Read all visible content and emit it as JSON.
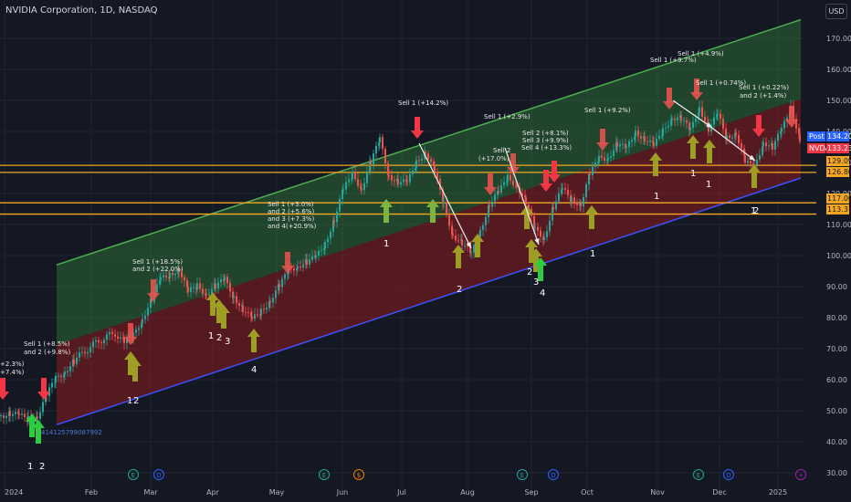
{
  "header": {
    "title": "NVIDIA Corporation, 1D, NASDAQ",
    "currency": "USD"
  },
  "chart_data": {
    "type": "candlestick",
    "title": "NVIDIA Corporation, 1D, NASDAQ",
    "ylim": [
      28,
      180
    ],
    "y_ticks": [
      30,
      40,
      50,
      60,
      70,
      80,
      90,
      100,
      110,
      120,
      130,
      140,
      150,
      160,
      170
    ],
    "x_tick_labels": [
      "2024",
      "Feb",
      "Mar",
      "Apr",
      "May",
      "Jun",
      "Jul",
      "Aug",
      "Sep",
      "Oct",
      "Nov",
      "Dec",
      "2025"
    ],
    "grid": true,
    "channel": {
      "upper_start": 97,
      "upper_end": 176,
      "lower_start": 45.5,
      "lower_end": 125
    },
    "horizontal_levels": [
      129.09,
      126.8,
      117.0,
      113.37
    ],
    "price_tags": [
      {
        "label": "Post",
        "value": "134.20",
        "color": "#2962ff"
      },
      {
        "label": "NVDA",
        "value": "133.23",
        "color": "#f23645"
      },
      {
        "label": "",
        "value": "129.09",
        "color": "#f5a623"
      },
      {
        "label": "",
        "value": "126.80",
        "color": "#f5a623"
      },
      {
        "label": "",
        "value": "117.00",
        "color": "#f5a623"
      },
      {
        "label": "",
        "value": "113.37",
        "color": "#f5a623"
      }
    ],
    "price_path": [
      [
        0,
        48.5
      ],
      [
        10,
        49.5
      ],
      [
        20,
        48
      ],
      [
        30,
        47.5
      ],
      [
        40,
        48.5
      ],
      [
        50,
        55
      ],
      [
        60,
        60
      ],
      [
        70,
        63
      ],
      [
        80,
        66
      ],
      [
        95,
        70
      ],
      [
        110,
        73
      ],
      [
        125,
        75
      ],
      [
        135,
        72
      ],
      [
        145,
        74
      ],
      [
        155,
        80
      ],
      [
        165,
        86
      ],
      [
        175,
        92
      ],
      [
        185,
        94
      ],
      [
        195,
        96
      ],
      [
        205,
        88
      ],
      [
        215,
        90
      ],
      [
        225,
        88
      ],
      [
        235,
        90
      ],
      [
        245,
        92
      ],
      [
        255,
        87
      ],
      [
        265,
        83
      ],
      [
        275,
        79
      ],
      [
        285,
        82
      ],
      [
        295,
        86
      ],
      [
        305,
        90
      ],
      [
        315,
        95
      ],
      [
        325,
        97
      ],
      [
        335,
        98
      ],
      [
        345,
        99
      ],
      [
        355,
        104
      ],
      [
        365,
        112
      ],
      [
        375,
        121
      ],
      [
        385,
        126
      ],
      [
        395,
        122
      ],
      [
        405,
        130
      ],
      [
        415,
        137
      ],
      [
        425,
        126
      ],
      [
        435,
        124
      ],
      [
        445,
        123
      ],
      [
        455,
        130
      ],
      [
        465,
        134
      ],
      [
        475,
        127
      ],
      [
        485,
        116
      ],
      [
        495,
        107
      ],
      [
        505,
        104
      ],
      [
        515,
        100
      ],
      [
        525,
        108
      ],
      [
        535,
        117
      ],
      [
        545,
        120
      ],
      [
        555,
        125
      ],
      [
        565,
        123
      ],
      [
        575,
        117
      ],
      [
        585,
        108
      ],
      [
        595,
        106
      ],
      [
        605,
        116
      ],
      [
        615,
        121
      ],
      [
        625,
        118
      ],
      [
        635,
        117
      ],
      [
        645,
        126
      ],
      [
        655,
        131
      ],
      [
        665,
        132
      ],
      [
        675,
        136
      ],
      [
        685,
        134
      ],
      [
        695,
        140
      ],
      [
        705,
        138
      ],
      [
        715,
        135
      ],
      [
        725,
        140
      ],
      [
        735,
        145
      ],
      [
        745,
        144
      ],
      [
        755,
        140
      ],
      [
        765,
        148
      ],
      [
        775,
        141
      ],
      [
        785,
        145
      ],
      [
        795,
        138
      ],
      [
        805,
        140
      ],
      [
        815,
        130
      ],
      [
        825,
        128
      ],
      [
        835,
        137
      ],
      [
        845,
        135
      ],
      [
        855,
        140
      ],
      [
        865,
        148
      ],
      [
        875,
        138
      ],
      [
        878,
        133
      ]
    ],
    "sell_annotations": [
      {
        "text": "+2.3%)"
      },
      {
        "text": "+7.4%)"
      },
      {
        "text": "Sell 1 (+8.5%)"
      },
      {
        "text": "and 2 (+9.8%)"
      },
      {
        "text": "Sell 1 (+18.5%)"
      },
      {
        "text": "and 2 (+22.0%)"
      },
      {
        "text": "Sell 1 (+3.0%)"
      },
      {
        "text": "and 2 (+5.6%)"
      },
      {
        "text": "and 3 (+7.3%)"
      },
      {
        "text": "and 4(+20.9%)"
      },
      {
        "text": "Sell 1 (+14.2%)"
      },
      {
        "text": "Sell 1 (+2.9%)"
      },
      {
        "text": "Sell 2"
      },
      {
        "text": "(+17.0%)"
      },
      {
        "text": "Sell 2 (+8.1%)"
      },
      {
        "text": "Sell 3 (+9.9%)"
      },
      {
        "text": "Sell 4 (+13.3%)"
      },
      {
        "text": "Sell 1 (+9.2%)"
      },
      {
        "text": "Sell 1 (+9.7%)"
      },
      {
        "text": "Sell 1 (+4.9%)"
      },
      {
        "text": "Sell 1 (+0.74%)"
      },
      {
        "text": "Sell 1 (+0.22%)"
      },
      {
        "text": "and 2 (+1.4%)"
      }
    ],
    "buy_counts": [
      "1",
      "2",
      "1",
      "2",
      "1",
      "2",
      "3",
      "4",
      "1",
      "2",
      "2",
      "3",
      "4",
      "1",
      "1",
      "1",
      "1",
      "1",
      "2"
    ],
    "misc_label": "414125799087992"
  }
}
